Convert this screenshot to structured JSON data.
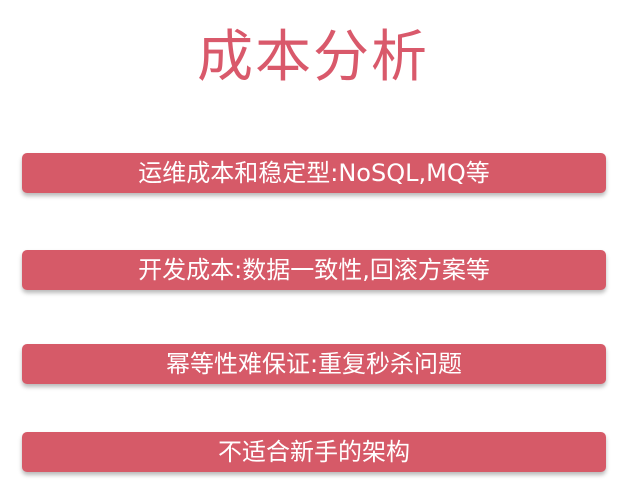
{
  "slide": {
    "title": "成本分析",
    "items": [
      {
        "text": "运维成本和稳定型:NoSQL,MQ等"
      },
      {
        "text": "开发成本:数据一致性,回滚方案等"
      },
      {
        "text": "幂等性难保证:重复秒杀问题"
      },
      {
        "text": "不适合新手的架构"
      }
    ]
  },
  "colors": {
    "title": "#d9596b",
    "bar_background": "#d65a68",
    "bar_text": "#ffffff",
    "background": "#ffffff"
  }
}
